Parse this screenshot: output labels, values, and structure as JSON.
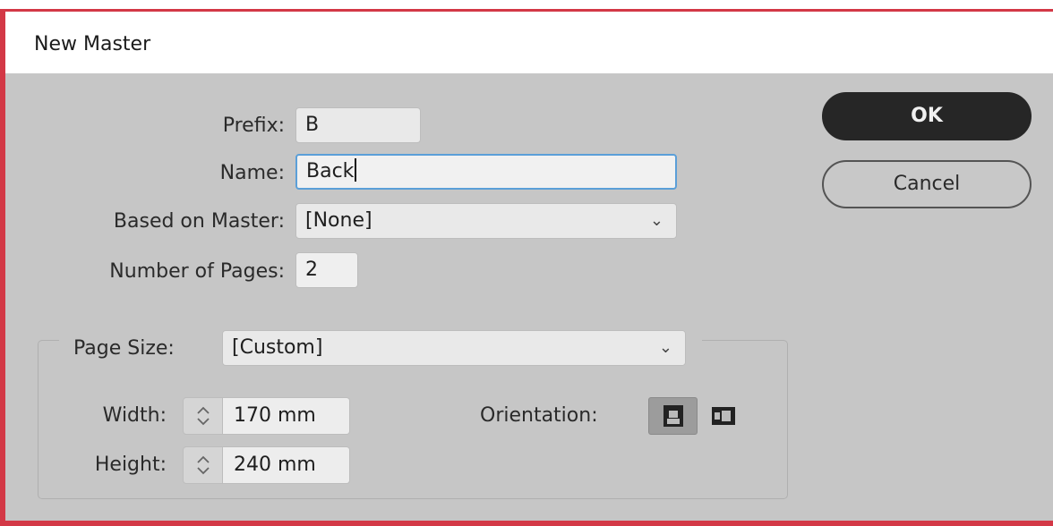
{
  "window": {
    "title": "New Master"
  },
  "form": {
    "prefix_label": "Prefix:",
    "prefix_value": "B",
    "name_label": "Name:",
    "name_value": "Back",
    "based_on_label": "Based on Master:",
    "based_on_value": "[None]",
    "pages_label": "Number of Pages:",
    "pages_value": "2"
  },
  "page_size": {
    "label": "Page Size:",
    "value": "[Custom]",
    "width_label": "Width:",
    "width_value": "170 mm",
    "height_label": "Height:",
    "height_value": "240 mm",
    "orientation_label": "Orientation:",
    "orientation_selected": "portrait"
  },
  "buttons": {
    "ok": "OK",
    "cancel": "Cancel"
  },
  "icons": {
    "chevron": "chevron-down-icon",
    "stepper": "stepper-arrows-icon",
    "portrait": "portrait-orientation-icon",
    "landscape": "landscape-orientation-icon"
  },
  "colors": {
    "frame": "#d33846",
    "dialog_bg": "#c6c6c6",
    "focus": "#5b9fd8",
    "ok_bg": "#262626"
  }
}
